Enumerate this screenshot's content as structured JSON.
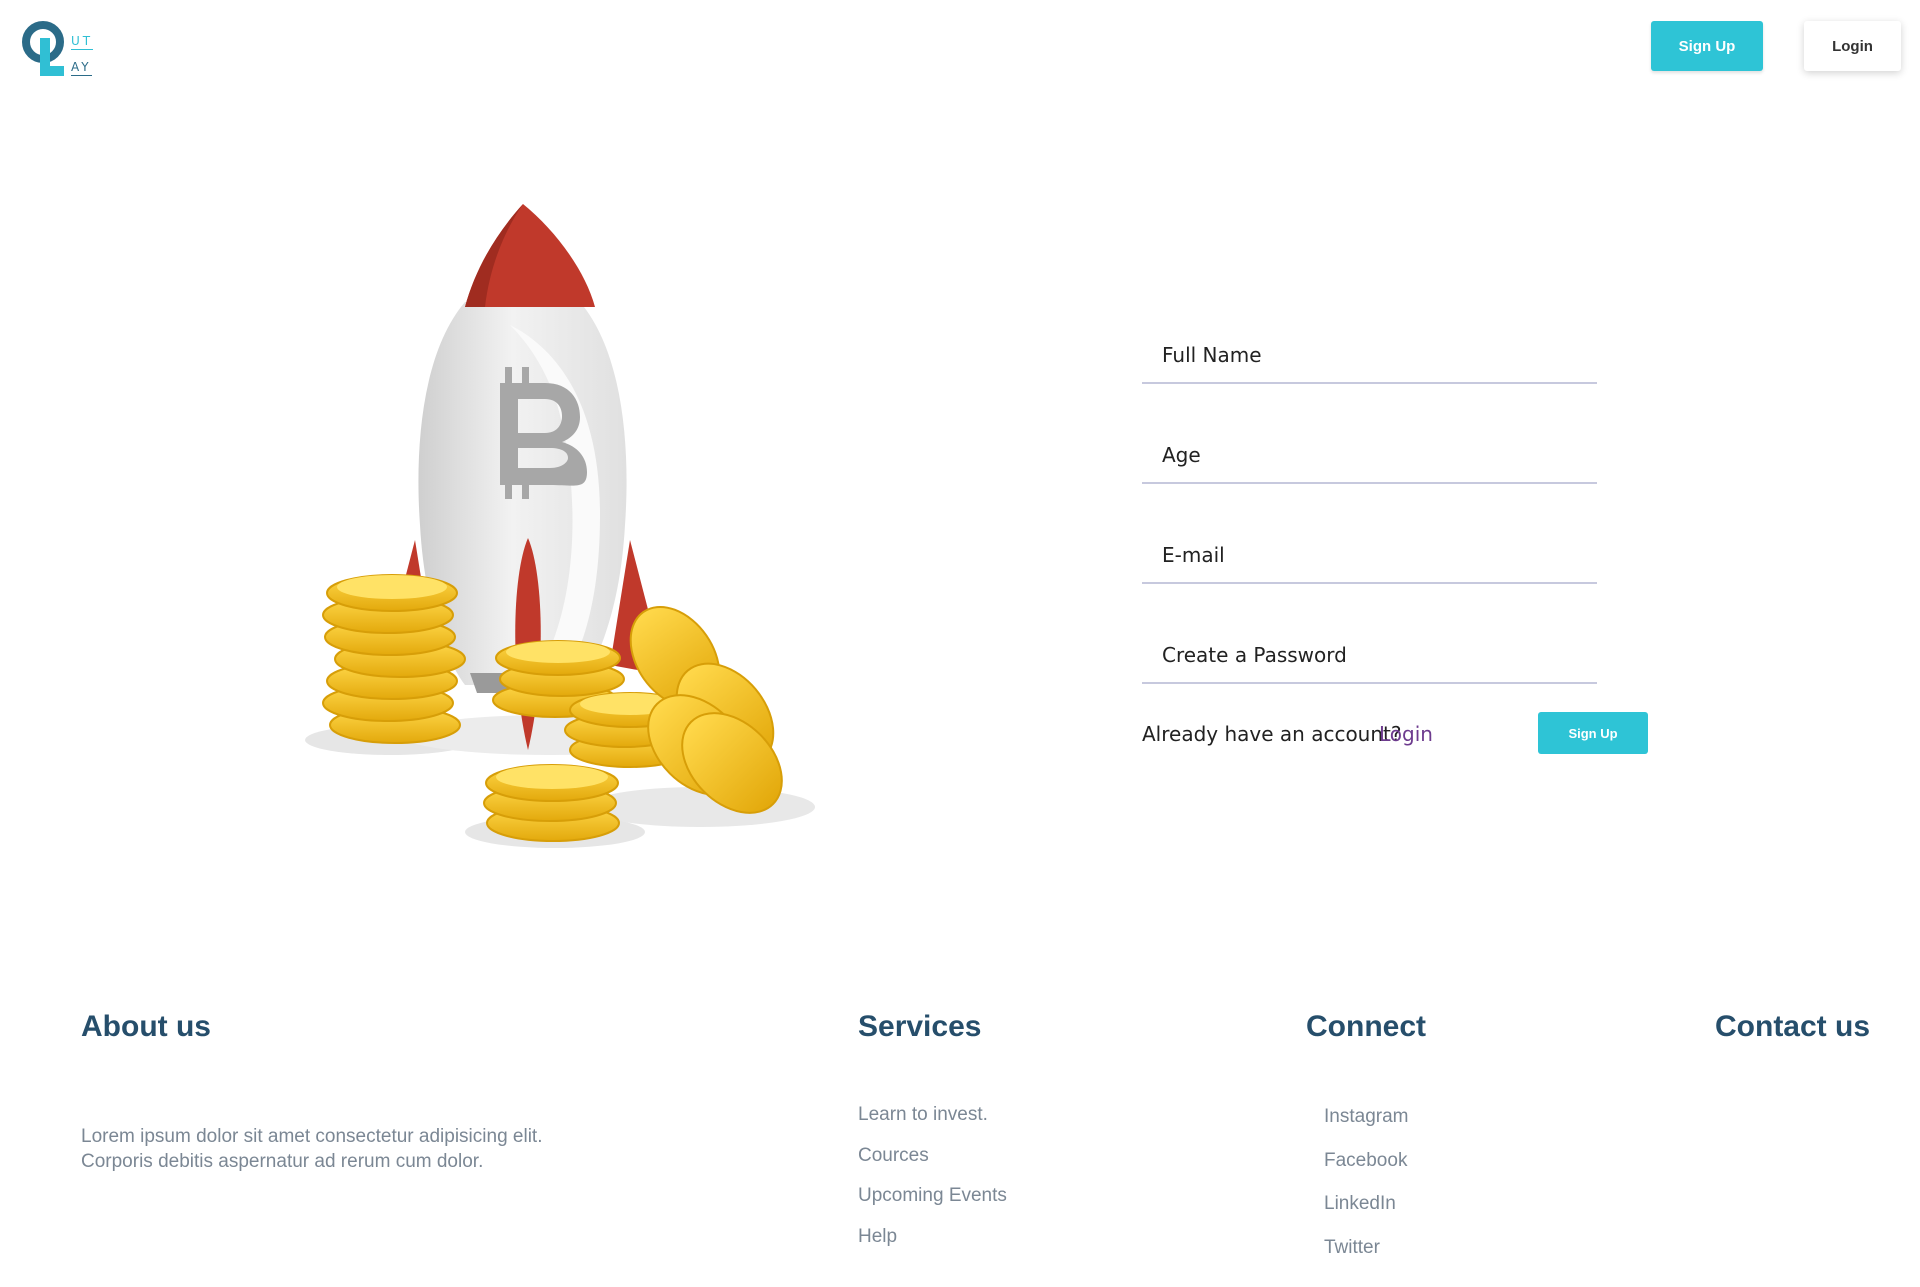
{
  "header": {
    "logo": {
      "letters": [
        "Q",
        "L"
      ],
      "text_top": "UT",
      "text_bottom": "AY",
      "colors": {
        "dark": "#2b6b88",
        "light": "#30bfd4"
      }
    },
    "signup_label": "Sign Up",
    "login_label": "Login"
  },
  "hero": {
    "illustration": "rocket-with-bitcoin-and-gold-coins",
    "symbol": "B"
  },
  "form": {
    "fields": [
      {
        "placeholder": "Full Name"
      },
      {
        "placeholder": "Age"
      },
      {
        "placeholder": "E-mail"
      },
      {
        "placeholder": "Create a Password"
      }
    ],
    "already_text": "Already have an account?",
    "login_link": "Login",
    "signup_button": "Sign Up"
  },
  "footer": {
    "about": {
      "title": "About us",
      "text": "Lorem ipsum dolor sit amet consectetur adipisicing elit. Corporis debitis aspernatur ad rerum cum dolor."
    },
    "services": {
      "title": "Services",
      "links": [
        "Learn to invest.",
        "Cources",
        "Upcoming Events",
        "Help"
      ]
    },
    "connect": {
      "title": "Connect",
      "links": [
        "Instagram",
        "Facebook",
        "LinkedIn",
        "Twitter"
      ]
    },
    "contact": {
      "title": "Contact us"
    }
  },
  "colors": {
    "accent": "#2ec4d6",
    "heading": "#264e6b",
    "muted_text": "#7b8794",
    "link_purple": "#6d3b8e",
    "rocket_red": "#c0392b",
    "coin_gold": "#f5c518"
  }
}
